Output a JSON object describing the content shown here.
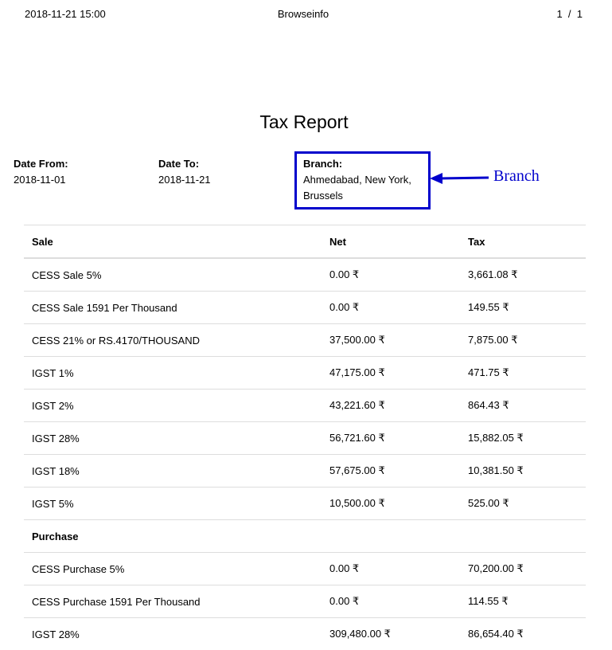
{
  "page_header": {
    "datetime": "2018-11-21 15:00",
    "title": "Browseinfo",
    "page_number": "1",
    "page_separator": "/",
    "page_total": "1"
  },
  "report": {
    "title": "Tax Report",
    "date_from_label": "Date From:",
    "date_from": "2018-11-01",
    "date_to_label": "Date To:",
    "date_to": "2018-11-21",
    "branch_label": "Branch:",
    "branch_value": "Ahmedabad, New York, Brussels"
  },
  "annotation": {
    "label": "Branch",
    "color": "#0000cc"
  },
  "table": {
    "headers": [
      "Sale",
      "Net",
      "Tax"
    ],
    "sale_rows": [
      {
        "name": "CESS Sale 5%",
        "net": "0.00 ₹",
        "tax": "3,661.08 ₹"
      },
      {
        "name": "CESS Sale 1591 Per Thousand",
        "net": "0.00 ₹",
        "tax": "149.55 ₹"
      },
      {
        "name": "CESS 21% or RS.4170/THOUSAND",
        "net": "37,500.00 ₹",
        "tax": "7,875.00 ₹"
      },
      {
        "name": "IGST 1%",
        "net": "47,175.00 ₹",
        "tax": "471.75 ₹"
      },
      {
        "name": "IGST 2%",
        "net": "43,221.60 ₹",
        "tax": "864.43 ₹"
      },
      {
        "name": "IGST 28%",
        "net": "56,721.60 ₹",
        "tax": "15,882.05 ₹"
      },
      {
        "name": "IGST 18%",
        "net": "57,675.00 ₹",
        "tax": "10,381.50 ₹"
      },
      {
        "name": "IGST 5%",
        "net": "10,500.00 ₹",
        "tax": "525.00 ₹"
      }
    ],
    "purchase_heading": "Purchase",
    "purchase_rows": [
      {
        "name": "CESS Purchase 5%",
        "net": "0.00 ₹",
        "tax": "70,200.00 ₹"
      },
      {
        "name": "CESS Purchase 1591 Per Thousand",
        "net": "0.00 ₹",
        "tax": "114.55 ₹"
      },
      {
        "name": "IGST 28%",
        "net": "309,480.00 ₹",
        "tax": "86,654.40 ₹"
      }
    ]
  }
}
